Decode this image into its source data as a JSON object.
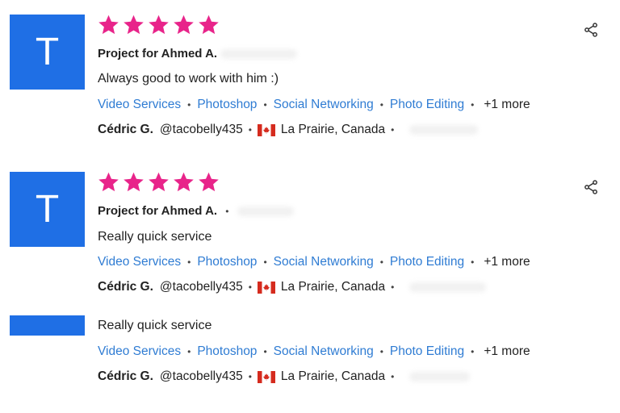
{
  "colors": {
    "avatar_bg": "#1f6fe5",
    "star": "#e8248a",
    "link": "#2f7cd3"
  },
  "reviews": [
    {
      "avatar_letter": "T",
      "project": "Project for Ahmed A.",
      "comment": "Always good to work with him :)",
      "tags": [
        "Video Services",
        "Photoshop",
        "Social Networking",
        "Photo Editing"
      ],
      "more": "+1 more",
      "reviewer_name": "Cédric G.",
      "reviewer_handle": "@tacobelly435",
      "location": "La Prairie, Canada",
      "rating": 5
    },
    {
      "avatar_letter": "T",
      "project": "Project for Ahmed A.",
      "comment": "Really quick service",
      "tags": [
        "Video Services",
        "Photoshop",
        "Social Networking",
        "Photo Editing"
      ],
      "more": "+1 more",
      "reviewer_name": "Cédric G.",
      "reviewer_handle": "@tacobelly435",
      "location": "La Prairie, Canada",
      "rating": 5
    },
    {
      "comment": "Really quick service",
      "tags": [
        "Video Services",
        "Photoshop",
        "Social Networking",
        "Photo Editing"
      ],
      "more": "+1 more",
      "reviewer_name": "Cédric G.",
      "reviewer_handle": "@tacobelly435",
      "location": "La Prairie, Canada"
    }
  ]
}
